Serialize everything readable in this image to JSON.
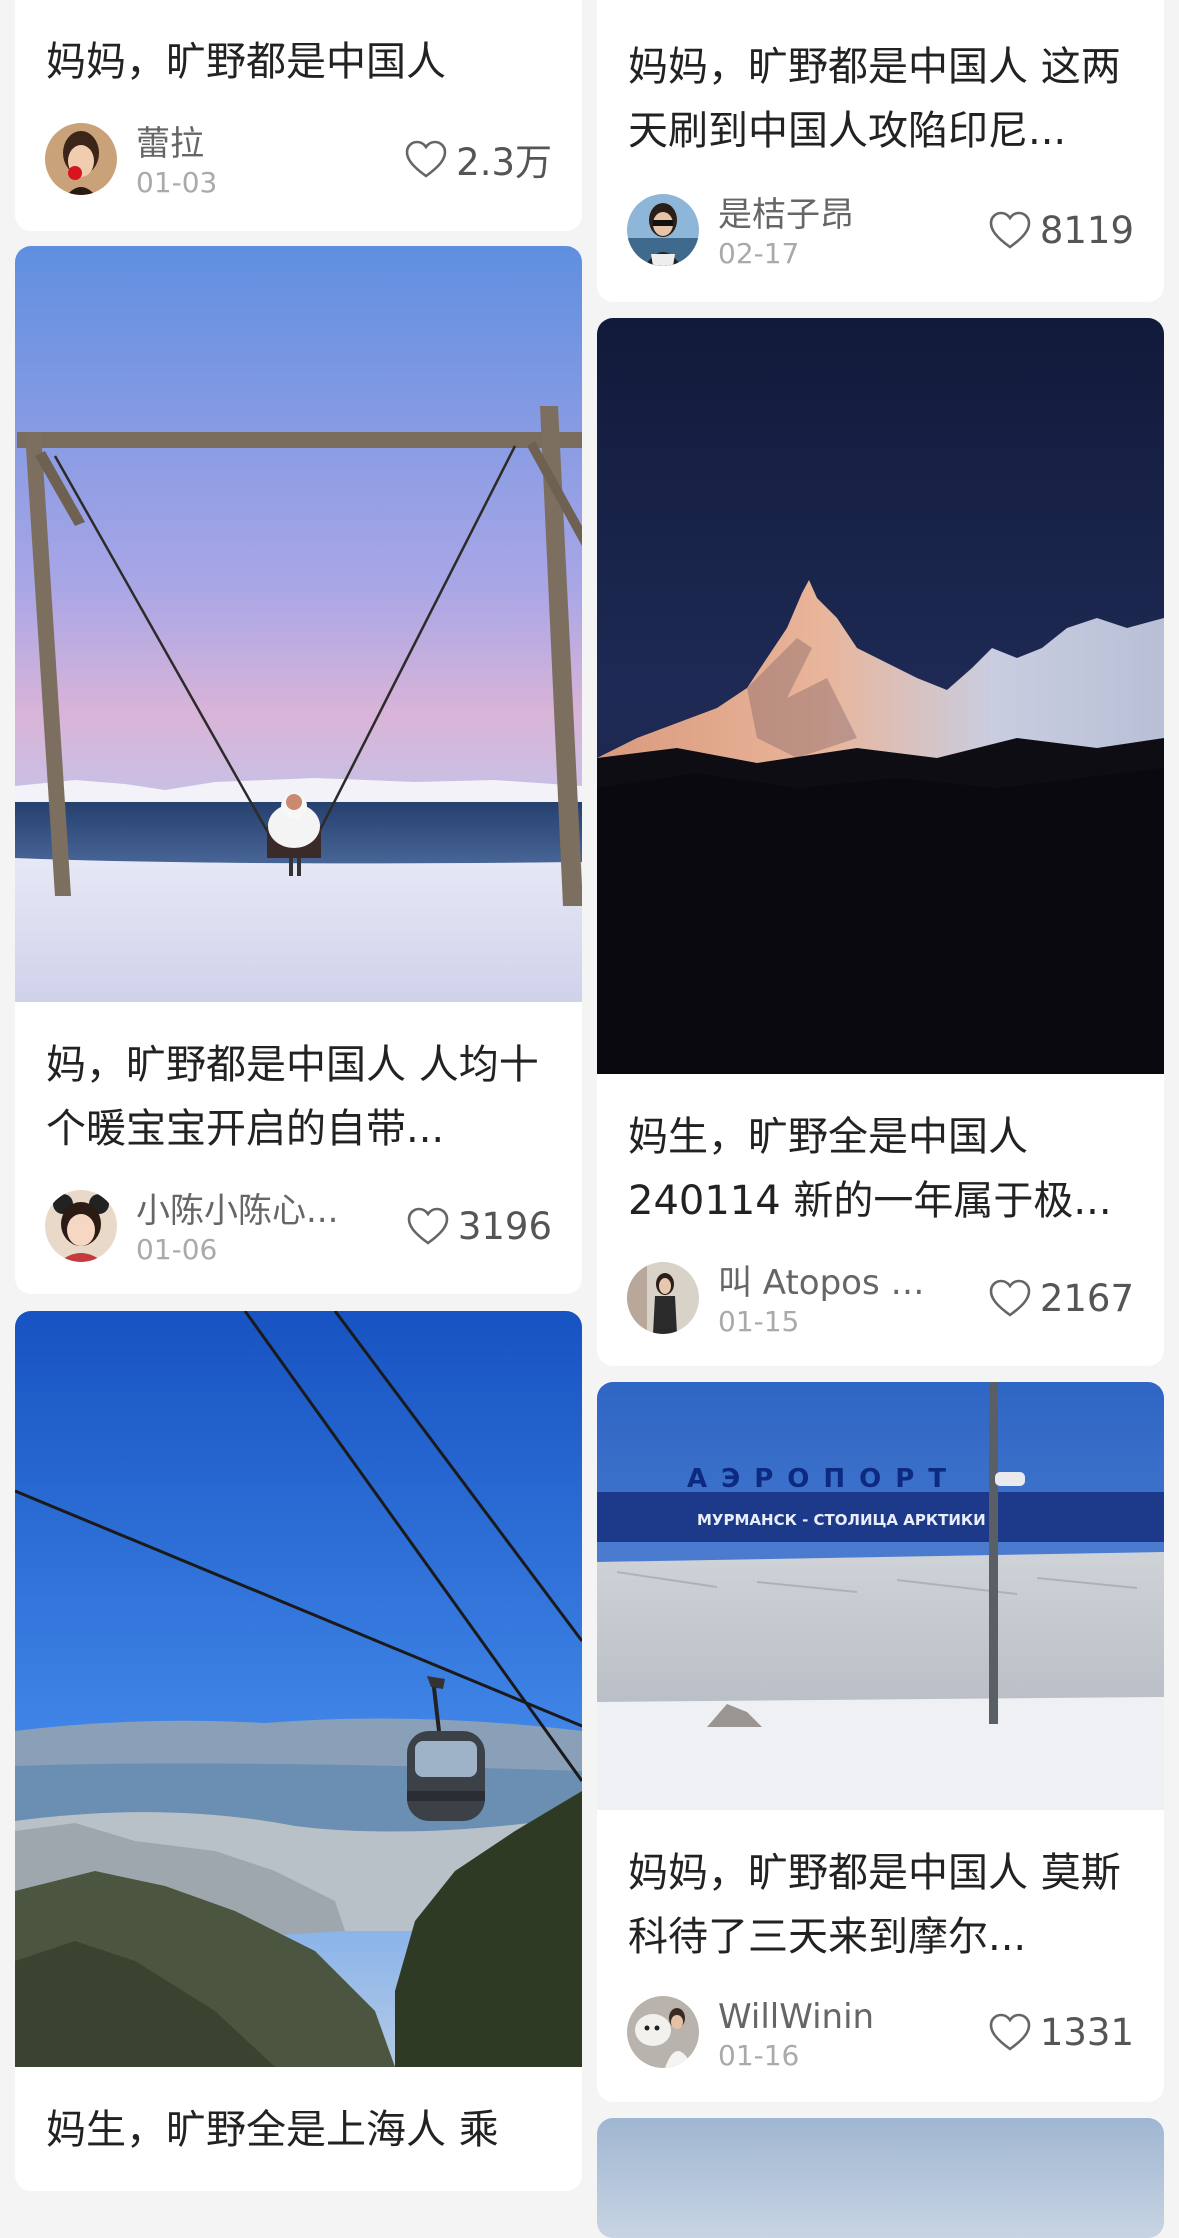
{
  "feed": {
    "cards": [
      {
        "title": "妈妈，旷野都是中国人",
        "author": "蕾拉",
        "date": "01-03",
        "likes": "2.3万",
        "avatar_icon": "avatar-woman-red-rose"
      },
      {
        "title": "妈妈，旷野都是中国人 这两天刷到中国人攻陷印尼...",
        "author": "是桔子昂",
        "date": "02-17",
        "likes": "8119",
        "avatar_icon": "avatar-woman-sunglasses"
      },
      {
        "title": "妈，旷野都是中国人 人均十个暖宝宝开启的自带...",
        "author": "小陈小陈心...",
        "date": "01-06",
        "likes": "3196",
        "image": "swing-in-snow-by-arctic-sea",
        "avatar_icon": "avatar-girl-cartoon"
      },
      {
        "title": "妈生，旷野全是中国人 240114 新的一年属于极...",
        "author": "叫 Atopos 乖乖",
        "date": "01-15",
        "likes": "2167",
        "image": "snow-mountain-peak-at-dusk",
        "avatar_icon": "avatar-woman-standing"
      },
      {
        "title": "妈生，旷野全是上海人 乘",
        "image": "cable-car-over-mountains-and-lake"
      },
      {
        "title": "妈妈，旷野都是中国人 莫斯科待了三天来到摩尔...",
        "author": "WillWinin",
        "date": "01-16",
        "likes": "1331",
        "image": "murmansk-airport-snow-wall",
        "avatar_icon": "avatar-person-with-dog"
      }
    ],
    "airport_sign": {
      "line1": "АЭРОПОРТ",
      "line2": "МУРМАНСК - СТОЛИЦА АРКТИКИ"
    },
    "colors": {
      "background": "#f4f4f4",
      "card": "#ffffff",
      "title": "#222222",
      "author": "#666666",
      "date": "#aaaaaa"
    }
  }
}
